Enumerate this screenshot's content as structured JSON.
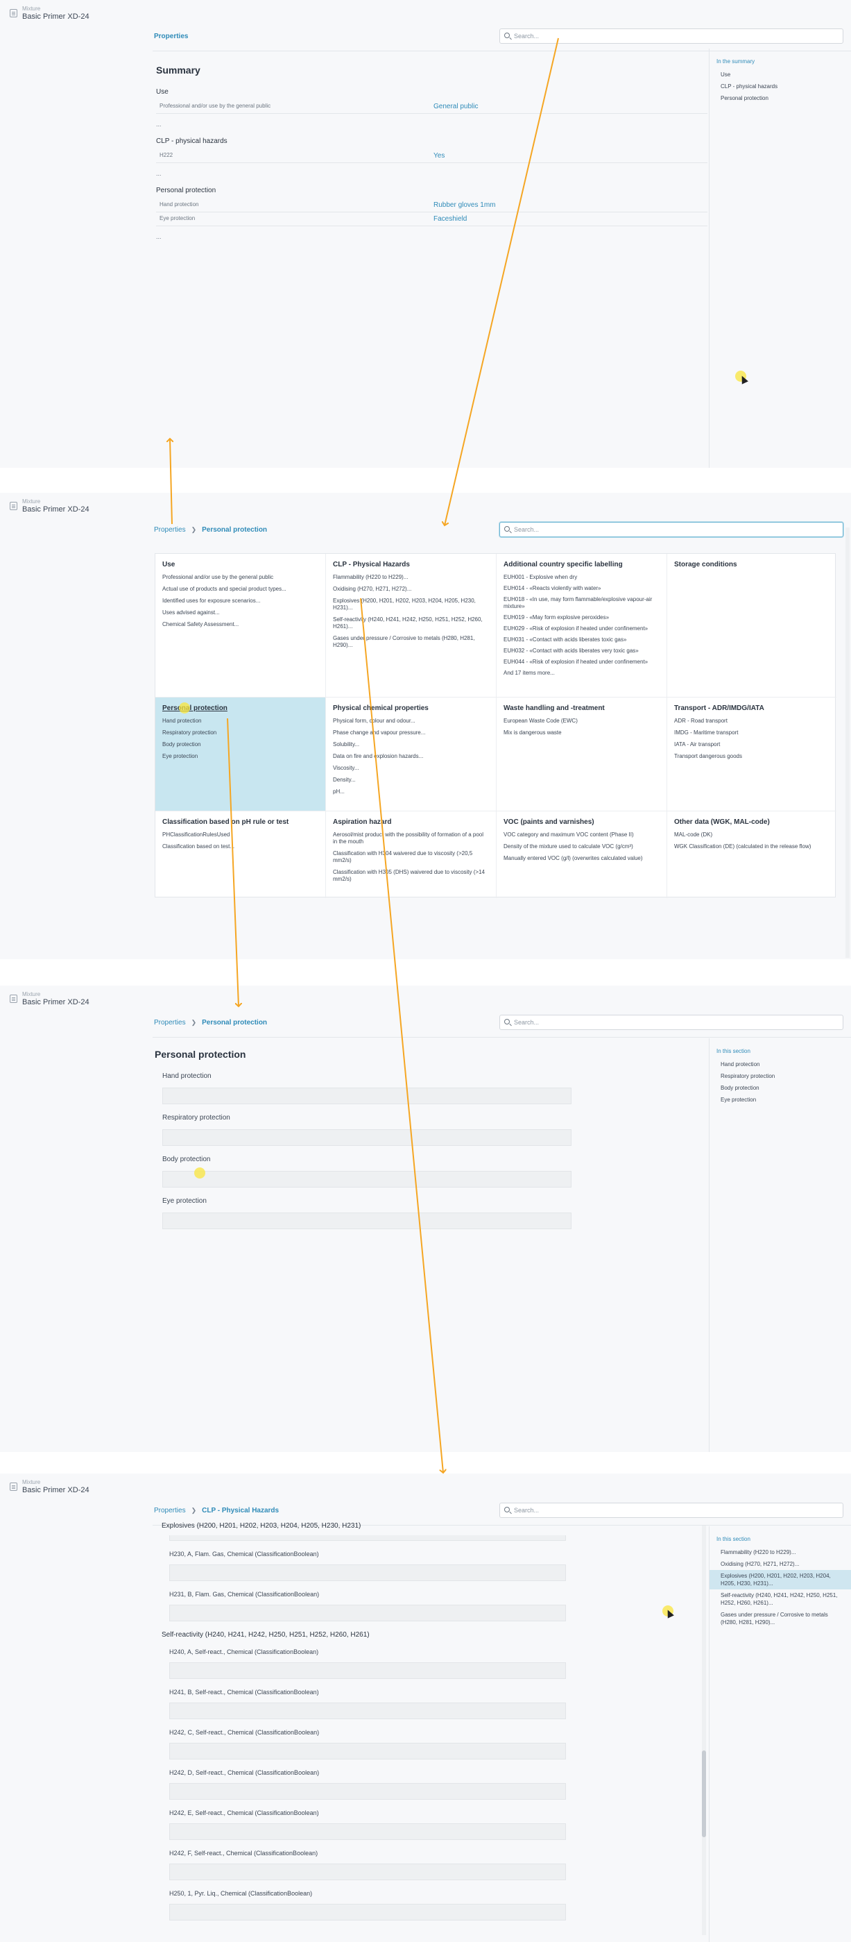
{
  "app": {
    "subtitle": "Mixture",
    "title": "Basic Primer XD-24"
  },
  "search_placeholder": "Search...",
  "breadcrumb_root": "Properties",
  "panel1": {
    "breadcrumb": "Properties",
    "heading": "Summary",
    "sections": [
      {
        "title": "Use",
        "rows": [
          {
            "label": "Professional and/or use by the general public",
            "value": "General public"
          }
        ]
      },
      {
        "title": "CLP - physical hazards",
        "rows": [
          {
            "label": "H222",
            "value": "Yes"
          }
        ]
      },
      {
        "title": "Personal protection",
        "rows": [
          {
            "label": "Hand protection",
            "value": "Rubber gloves 1mm"
          },
          {
            "label": "Eye protection",
            "value": "Faceshield"
          }
        ]
      }
    ],
    "ellipsis": "...",
    "toc_title": "In the summary",
    "toc": [
      "Use",
      "CLP - physical hazards",
      "Personal protection"
    ]
  },
  "panel2": {
    "breadcrumb_current": "Personal protection",
    "cards": [
      {
        "title": "Use",
        "items": [
          "Professional and/or use by the general public",
          "Actual use of products and special product types...",
          "Identified uses for exposure scenarios...",
          "Uses advised against...",
          "Chemical Safety Assessment..."
        ]
      },
      {
        "title": "CLP - Physical Hazards",
        "items": [
          "Flammability (H220 to H229)...",
          "Oxidising (H270, H271, H272)...",
          "Explosives (H200, H201, H202, H203, H204, H205, H230, H231)...",
          "Self-reactivity (H240, H241, H242, H250, H251, H252, H260, H261)...",
          "Gases under pressure / Corrosive to metals (H280, H281, H290)..."
        ]
      },
      {
        "title": "Additional country specific labelling",
        "items": [
          "EUH001 - Explosive when dry",
          "EUH014 - «Reacts violently with water»",
          "EUH018 - «In use, may form flammable/explosive vapour-air mixture»",
          "EUH019 - «May form explosive peroxides»",
          "EUH029 - «Risk of explosion if heated under confinement»",
          "EUH031 - «Contact with acids liberates toxic gas»",
          "EUH032 - «Contact with acids liberates very toxic gas»",
          "EUH044 - «Risk of explosion if heated under confinement»",
          "And 17 items more..."
        ]
      },
      {
        "title": "Storage conditions",
        "items": []
      },
      {
        "title": "Personal protection",
        "items": [
          "Hand protection",
          "Respiratory protection",
          "Body protection",
          "Eye protection"
        ]
      },
      {
        "title": "Physical chemical properties",
        "items": [
          "Physical form, colour and odour...",
          "Phase change and vapour pressure...",
          "Solubility...",
          "Data on fire and explosion hazards...",
          "Viscosity...",
          "Density...",
          "pH..."
        ]
      },
      {
        "title": "Waste handling and -treatment",
        "items": [
          "European Waste Code (EWC)",
          "Mix is dangerous waste"
        ]
      },
      {
        "title": "Transport - ADR/IMDG/IATA",
        "items": [
          "ADR - Road transport",
          "IMDG - Maritime transport",
          "IATA - Air transport",
          "Transport dangerous goods"
        ]
      },
      {
        "title": "Classification based on pH rule or test",
        "items": [
          "PHClassificationRulesUsed",
          "Classification based on test..."
        ]
      },
      {
        "title": "Aspiration hazard",
        "items": [
          "Aerosol/mist product with the possibility of formation of a pool in the mouth",
          "Classification with H304 waivered due to viscosity (>20,5 mm2/s)",
          "Classification with H305 (DHS) waivered due to viscosity (>14 mm2/s)"
        ]
      },
      {
        "title": "VOC (paints and varnishes)",
        "items": [
          "VOC category and maximum VOC content (Phase II)",
          "Density of the mixture used to calculate VOC (g/cm³)",
          "Manually entered VOC (g/l) (overwrites calculated value)"
        ]
      },
      {
        "title": "Other data (WGK, MAL-code)",
        "items": [
          "MAL-code (DK)",
          "WGK Classification (DE) (calculated in the release flow)"
        ]
      }
    ]
  },
  "panel3": {
    "breadcrumb_current": "Personal protection",
    "heading": "Personal protection",
    "fields": [
      "Hand protection",
      "Respiratory protection",
      "Body protection",
      "Eye protection"
    ],
    "toc_title": "In this section",
    "toc": [
      "Hand protection",
      "Respiratory protection",
      "Body protection",
      "Eye protection"
    ]
  },
  "panel4": {
    "breadcrumb_current": "CLP - Physical Hazards",
    "group1": "Explosives (H200, H201, H202, H203, H204, H205, H230, H231)",
    "group1_fields": [
      "H230, A, Flam. Gas, Chemical (ClassificationBoolean)",
      "H231, B, Flam. Gas, Chemical (ClassificationBoolean)"
    ],
    "group2": "Self-reactivity (H240, H241, H242, H250, H251, H252, H260, H261)",
    "group2_fields": [
      "H240, A, Self-react., Chemical (ClassificationBoolean)",
      "H241, B, Self-react., Chemical (ClassificationBoolean)",
      "H242, C, Self-react., Chemical (ClassificationBoolean)",
      "H242, D, Self-react., Chemical (ClassificationBoolean)",
      "H242, E, Self-react., Chemical (ClassificationBoolean)",
      "H242, F, Self-react., Chemical (ClassificationBoolean)",
      "H250, 1, Pyr. Liq., Chemical (ClassificationBoolean)"
    ],
    "toc_title": "In this section",
    "toc": [
      "Flammability (H220 to H229)...",
      "Oxidising (H270, H271, H272)...",
      "Explosives (H200, H201, H202, H203, H204, H205, H230, H231)...",
      "Self-reactivity (H240, H241, H242, H250, H251, H252, H260, H261)...",
      "Gases under pressure / Corrosive to metals (H280, H281, H290)..."
    ],
    "toc_active_index": 2
  },
  "colors": {
    "accent": "#2f8bb8",
    "selected_card": "#c8e6f0",
    "arrow": "#f5a623",
    "background": "#f7f8fa"
  }
}
